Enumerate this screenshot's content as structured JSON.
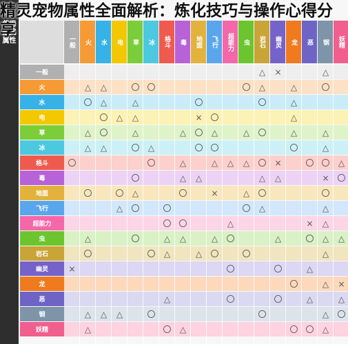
{
  "title": "精灵宠物属性全面解析：炼化技巧与操作心得分享",
  "left_title": "使用招式属性",
  "types": [
    {
      "name": "一般",
      "color": "#b0b0b0",
      "bg": "#eeeeee"
    },
    {
      "name": "火",
      "color": "#f59a35",
      "bg": "#fde1c6"
    },
    {
      "name": "水",
      "color": "#37b2e6",
      "bg": "#c9ecf8"
    },
    {
      "name": "电",
      "color": "#f3c800",
      "bg": "#fdf2b5"
    },
    {
      "name": "草",
      "color": "#7ccd3a",
      "bg": "#dff3c9"
    },
    {
      "name": "冰",
      "color": "#4cc8e0",
      "bg": "#cdf0f6"
    },
    {
      "name": "格斗",
      "color": "#ef5a4e",
      "bg": "#fcd0cc"
    },
    {
      "name": "毒",
      "color": "#b762d6",
      "bg": "#ecd3f5"
    },
    {
      "name": "地面",
      "color": "#e3b23c",
      "bg": "#f8e7bd"
    },
    {
      "name": "飞行",
      "color": "#5aa6ec",
      "bg": "#d2e7fb"
    },
    {
      "name": "超能力",
      "color": "#f467a8",
      "bg": "#fcd5e7"
    },
    {
      "name": "虫",
      "color": "#6cc52e",
      "bg": "#d9f1c5"
    },
    {
      "name": "岩石",
      "color": "#c9a437",
      "bg": "#f1e5bf"
    },
    {
      "name": "幽灵",
      "color": "#7563c9",
      "bg": "#dcd7f2"
    },
    {
      "name": "龙",
      "color": "#f07a1e",
      "bg": "#fcd9bc"
    },
    {
      "name": "恶",
      "color": "#6d64c6",
      "bg": "#dbd8f1"
    },
    {
      "name": "钢",
      "color": "#7e94a8",
      "bg": "#dde3ea"
    },
    {
      "name": "妖精",
      "color": "#f05f8e",
      "bg": "#fcd3df"
    }
  ],
  "rows": [
    {
      "attacker": "一般",
      "cells": [
        "",
        "",
        "",
        "",
        "",
        "",
        "",
        "",
        "",
        "",
        "",
        "",
        "△",
        "×",
        "",
        "",
        "△",
        ""
      ]
    },
    {
      "attacker": "火",
      "cells": [
        "",
        "△",
        "△",
        "",
        "〇",
        "〇",
        "",
        "",
        "",
        "",
        "",
        "〇",
        "△",
        "",
        "△",
        "",
        "〇",
        ""
      ]
    },
    {
      "attacker": "水",
      "cells": [
        "",
        "〇",
        "△",
        "",
        "△",
        "",
        "",
        "",
        "〇",
        "",
        "",
        "",
        "〇",
        "",
        "△",
        "",
        "",
        ""
      ]
    },
    {
      "attacker": "电",
      "cells": [
        "",
        "",
        "〇",
        "△",
        "△",
        "",
        "",
        "",
        "×",
        "〇",
        "",
        "",
        "",
        "",
        "△",
        "",
        "",
        ""
      ]
    },
    {
      "attacker": "草",
      "cells": [
        "",
        "△",
        "〇",
        "",
        "△",
        "",
        "",
        "△",
        "〇",
        "△",
        "",
        "△",
        "〇",
        "",
        "△",
        "",
        "△",
        ""
      ]
    },
    {
      "attacker": "冰",
      "cells": [
        "",
        "△",
        "△",
        "",
        "〇",
        "△",
        "",
        "",
        "〇",
        "〇",
        "",
        "",
        "",
        "",
        "〇",
        "",
        "△",
        ""
      ]
    },
    {
      "attacker": "格斗",
      "cells": [
        "〇",
        "",
        "",
        "",
        "",
        "〇",
        "",
        "△",
        "",
        "△",
        "△",
        "△",
        "〇",
        "×",
        "",
        "〇",
        "〇",
        "△"
      ]
    },
    {
      "attacker": "毒",
      "cells": [
        "",
        "",
        "",
        "",
        "〇",
        "",
        "",
        "△",
        "△",
        "",
        "",
        "",
        "△",
        "△",
        "",
        "",
        "×",
        "〇"
      ]
    },
    {
      "attacker": "地面",
      "cells": [
        "",
        "〇",
        "",
        "〇",
        "△",
        "",
        "",
        "〇",
        "",
        "×",
        "",
        "△",
        "〇",
        "",
        "",
        "",
        "〇",
        ""
      ]
    },
    {
      "attacker": "飞行",
      "cells": [
        "",
        "",
        "",
        "△",
        "〇",
        "",
        "〇",
        "",
        "",
        "",
        "",
        "〇",
        "△",
        "",
        "",
        "",
        "△",
        ""
      ]
    },
    {
      "attacker": "超能力",
      "cells": [
        "",
        "",
        "",
        "",
        "",
        "",
        "〇",
        "〇",
        "",
        "",
        "△",
        "",
        "",
        "",
        "",
        "×",
        "△",
        ""
      ]
    },
    {
      "attacker": "虫",
      "cells": [
        "",
        "△",
        "",
        "",
        "〇",
        "",
        "△",
        "△",
        "",
        "△",
        "〇",
        "",
        "",
        "△",
        "",
        "〇",
        "△",
        "△"
      ]
    },
    {
      "attacker": "岩石",
      "cells": [
        "",
        "〇",
        "",
        "",
        "",
        "〇",
        "△",
        "",
        "△",
        "〇",
        "",
        "〇",
        "",
        "",
        "",
        "",
        "△",
        ""
      ]
    },
    {
      "attacker": "幽灵",
      "cells": [
        "×",
        "",
        "",
        "",
        "",
        "",
        "",
        "",
        "",
        "",
        "〇",
        "",
        "",
        "〇",
        "",
        "△",
        "",
        ""
      ]
    },
    {
      "attacker": "龙",
      "cells": [
        "",
        "",
        "",
        "",
        "",
        "",
        "",
        "",
        "",
        "",
        "",
        "",
        "",
        "",
        "〇",
        "",
        "△",
        "×"
      ]
    },
    {
      "attacker": "恶",
      "cells": [
        "",
        "",
        "",
        "",
        "",
        "",
        "△",
        "",
        "",
        "",
        "〇",
        "",
        "",
        "〇",
        "",
        "△",
        "",
        "△"
      ]
    },
    {
      "attacker": "钢",
      "cells": [
        "",
        "△",
        "△",
        "△",
        "",
        "〇",
        "",
        "",
        "",
        "",
        "",
        "",
        "〇",
        "",
        "",
        "",
        "△",
        "〇"
      ]
    },
    {
      "attacker": "妖精",
      "cells": [
        "",
        "△",
        "",
        "",
        "",
        "",
        "〇",
        "△",
        "",
        "",
        "",
        "",
        "",
        "",
        "〇",
        "〇",
        "△",
        ""
      ]
    }
  ]
}
